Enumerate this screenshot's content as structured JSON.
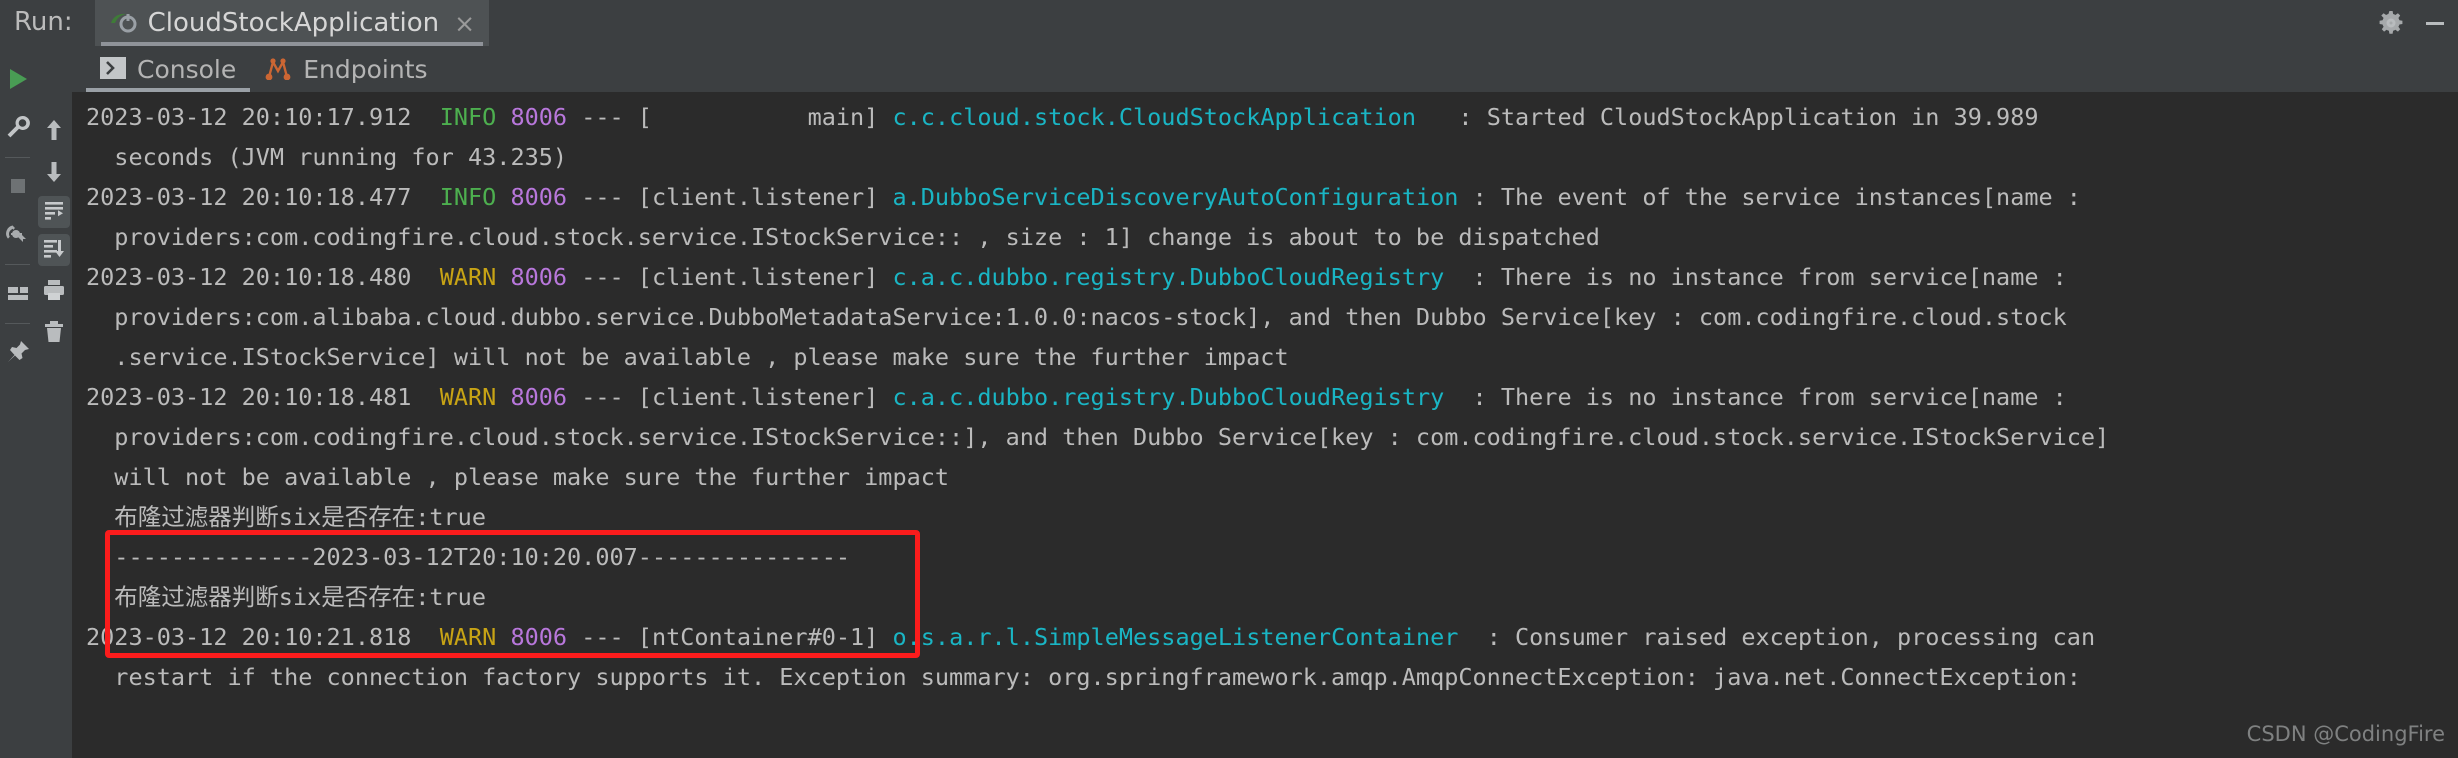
{
  "window": {
    "run_label": "Run:",
    "tab_title": "CloudStockApplication",
    "tab_close": "×",
    "settings_icon": "gear-icon",
    "minimize_icon": "minimize-icon"
  },
  "left_gutter": {
    "items": [
      {
        "name": "rerun-button",
        "icon": "play-icon"
      },
      {
        "name": "edit-configuration-button",
        "icon": "wrench-icon"
      },
      {
        "name": "stop-button",
        "icon": "stop-square-icon"
      },
      {
        "name": "restart-debugger-button",
        "icon": "restart-bug-icon"
      },
      {
        "name": "layout-button",
        "icon": "layout-icon"
      },
      {
        "name": "pin-tab-button",
        "icon": "pin-icon"
      }
    ]
  },
  "console_gutter": {
    "items": [
      {
        "name": "scroll-up-button",
        "icon": "arrow-up-icon"
      },
      {
        "name": "scroll-down-button",
        "icon": "arrow-down-icon"
      },
      {
        "name": "soft-wrap-button",
        "icon": "soft-wrap-icon",
        "active": true
      },
      {
        "name": "scroll-to-end-button",
        "icon": "scroll-to-end-icon",
        "active": true
      },
      {
        "name": "print-button",
        "icon": "printer-icon"
      },
      {
        "name": "clear-all-button",
        "icon": "trash-icon"
      }
    ]
  },
  "tabs": [
    {
      "label": "Console",
      "icon": "console-icon",
      "selected": true
    },
    {
      "label": "Endpoints",
      "icon": "endpoints-icon",
      "selected": false
    }
  ],
  "console": {
    "lines": [
      {
        "name": "log-line-started",
        "segments": [
          {
            "cls": "c-date",
            "text": "2023-03-12 20:10:17.912  "
          },
          {
            "cls": "c-info",
            "text": "INFO"
          },
          {
            "cls": "c-txt",
            "text": " "
          },
          {
            "cls": "c-pid",
            "text": "8006"
          },
          {
            "cls": "c-txt",
            "text": " --- [           main] "
          },
          {
            "cls": "c-cls",
            "text": "c.c.cloud.stock.CloudStockApplication"
          },
          {
            "cls": "c-txt",
            "text": "   : Started CloudStockApplication in 39.989"
          }
        ]
      },
      {
        "name": "log-line-started-cont",
        "segments": [
          {
            "cls": "c-txt",
            "text": "  seconds (JVM running for 43.235)"
          }
        ]
      },
      {
        "name": "log-line-dubbo-discovery",
        "segments": [
          {
            "cls": "c-date",
            "text": "2023-03-12 20:10:18.477  "
          },
          {
            "cls": "c-info",
            "text": "INFO"
          },
          {
            "cls": "c-txt",
            "text": " "
          },
          {
            "cls": "c-pid",
            "text": "8006"
          },
          {
            "cls": "c-txt",
            "text": " --- [client.listener] "
          },
          {
            "cls": "c-cls",
            "text": "a.DubboServiceDiscoveryAutoConfiguration"
          },
          {
            "cls": "c-txt",
            "text": " : The event of the service instances[name : "
          }
        ]
      },
      {
        "name": "log-line-dubbo-discovery-cont",
        "segments": [
          {
            "cls": "c-txt",
            "text": "  providers:com.codingfire.cloud.stock.service.IStockService:: , size : 1] change is about to be dispatched"
          }
        ]
      },
      {
        "name": "log-line-registry-warn-1",
        "segments": [
          {
            "cls": "c-date",
            "text": "2023-03-12 20:10:18.480  "
          },
          {
            "cls": "c-warn",
            "text": "WARN"
          },
          {
            "cls": "c-txt",
            "text": " "
          },
          {
            "cls": "c-pid",
            "text": "8006"
          },
          {
            "cls": "c-txt",
            "text": " --- [client.listener] "
          },
          {
            "cls": "c-cls",
            "text": "c.a.c.dubbo.registry.DubboCloudRegistry"
          },
          {
            "cls": "c-txt",
            "text": "  : There is no instance from service[name : "
          }
        ]
      },
      {
        "name": "log-line-registry-warn-1-cont-a",
        "segments": [
          {
            "cls": "c-txt",
            "text": "  providers:com.alibaba.cloud.dubbo.service.DubboMetadataService:1.0.0:nacos-stock], and then Dubbo Service[key : com.codingfire.cloud.stock"
          }
        ]
      },
      {
        "name": "log-line-registry-warn-1-cont-b",
        "segments": [
          {
            "cls": "c-txt",
            "text": "  .service.IStockService] will not be available , please make sure the further impact"
          }
        ]
      },
      {
        "name": "log-line-registry-warn-2",
        "segments": [
          {
            "cls": "c-date",
            "text": "2023-03-12 20:10:18.481  "
          },
          {
            "cls": "c-warn",
            "text": "WARN"
          },
          {
            "cls": "c-txt",
            "text": " "
          },
          {
            "cls": "c-pid",
            "text": "8006"
          },
          {
            "cls": "c-txt",
            "text": " --- [client.listener] "
          },
          {
            "cls": "c-cls",
            "text": "c.a.c.dubbo.registry.DubboCloudRegistry"
          },
          {
            "cls": "c-txt",
            "text": "  : There is no instance from service[name : "
          }
        ]
      },
      {
        "name": "log-line-registry-warn-2-cont-a",
        "segments": [
          {
            "cls": "c-txt",
            "text": "  providers:com.codingfire.cloud.stock.service.IStockService::], and then Dubbo Service[key : com.codingfire.cloud.stock.service.IStockService]"
          }
        ]
      },
      {
        "name": "log-line-registry-warn-2-cont-b",
        "segments": [
          {
            "cls": "c-txt",
            "text": "  will not be available , please make sure the further impact"
          }
        ]
      },
      {
        "name": "log-line-bloom-filter-1",
        "segments": [
          {
            "cls": "c-txt",
            "text": "  布隆过滤器判断six是否存在:true"
          }
        ]
      },
      {
        "name": "log-line-separator-timestamp",
        "segments": [
          {
            "cls": "c-txt",
            "text": "  --------------2023-03-12T20:10:20.007---------------"
          }
        ]
      },
      {
        "name": "log-line-bloom-filter-2",
        "segments": [
          {
            "cls": "c-txt",
            "text": "  布隆过滤器判断six是否存在:true"
          }
        ]
      },
      {
        "name": "log-line-amqp-warn",
        "segments": [
          {
            "cls": "c-date",
            "text": "2023-03-12 20:10:21.818  "
          },
          {
            "cls": "c-warn",
            "text": "WARN"
          },
          {
            "cls": "c-txt",
            "text": " "
          },
          {
            "cls": "c-pid",
            "text": "8006"
          },
          {
            "cls": "c-txt",
            "text": " --- [ntContainer#0-1] "
          },
          {
            "cls": "c-cls",
            "text": "o.s.a.r.l.SimpleMessageListenerContainer"
          },
          {
            "cls": "c-txt",
            "text": "  : Consumer raised exception, processing can"
          }
        ]
      },
      {
        "name": "log-line-amqp-warn-cont",
        "segments": [
          {
            "cls": "c-txt",
            "text": "  restart if the connection factory supports it. Exception summary: org.springframework.amqp.AmqpConnectException: java.net.ConnectException:"
          }
        ]
      }
    ]
  },
  "annotation": {
    "highlight_box_color": "#fb1c1c"
  },
  "watermark": {
    "text": "CSDN @CodingFire"
  }
}
